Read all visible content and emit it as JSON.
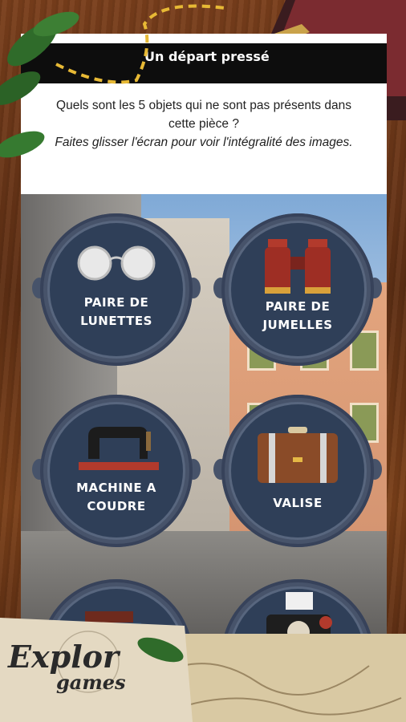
{
  "header": {
    "title": "Un départ pressé"
  },
  "question": {
    "line1": "Quels sont les 5 objets qui ne sont pas présents dans cette pièce ?",
    "line2": "Faites glisser l'écran pour voir l'intégralité des images."
  },
  "items": [
    {
      "label1": "PAIRE DE",
      "label2": "LUNETTES",
      "icon": "glasses-icon"
    },
    {
      "label1": "PAIRE DE",
      "label2": "JUMELLES",
      "icon": "binoculars-icon"
    },
    {
      "label1": "MACHINE A",
      "label2": "COUDRE",
      "icon": "sewing-machine-icon"
    },
    {
      "label1": "VALISE",
      "label2": "",
      "icon": "suitcase-icon"
    },
    {
      "label1": "",
      "label2": "",
      "icon": "books-icon"
    },
    {
      "label1": "",
      "label2": "",
      "icon": "camera-icon"
    }
  ],
  "brand": {
    "logo_text_1": "Explor",
    "logo_text_2": "games"
  },
  "colors": {
    "tile": "#47536a",
    "tile_inner": "#2f3f58",
    "header": "#0d0d0d"
  }
}
